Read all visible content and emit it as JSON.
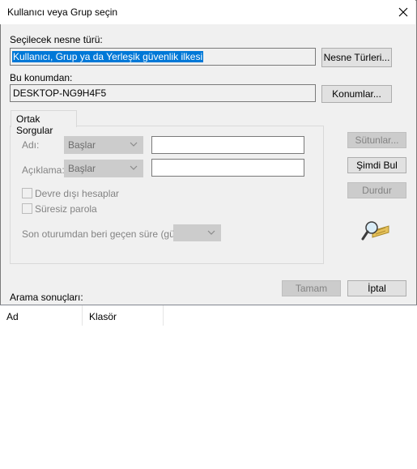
{
  "window": {
    "title": "Kullanıcı veya Grup seçin"
  },
  "object_type": {
    "label": "Seçilecek nesne türü:",
    "value": "Kullanıcı, Grup ya da Yerleşik güvenlik ilkesi",
    "button": "Nesne Türleri..."
  },
  "location": {
    "label": "Bu konumdan:",
    "value": "DESKTOP-NG9H4F5",
    "button": "Konumlar..."
  },
  "tab": {
    "label": "Ortak Sorgular"
  },
  "query": {
    "name_label": "Adı:",
    "name_combo": "Başlar",
    "desc_label": "Açıklama:",
    "desc_combo": "Başlar",
    "disabled_accounts": "Devre dışı hesaplar",
    "non_expiring_pw": "Süresiz parola",
    "days_label": "Son oturumdan beri geçen süre (gün):"
  },
  "side_buttons": {
    "columns": "Sütunlar...",
    "find_now": "Şimdi Bul",
    "stop": "Durdur"
  },
  "footer": {
    "ok": "Tamam",
    "cancel": "İptal"
  },
  "results": {
    "label": "Arama sonuçları:",
    "columns": [
      "Ad",
      "Klasör"
    ]
  }
}
